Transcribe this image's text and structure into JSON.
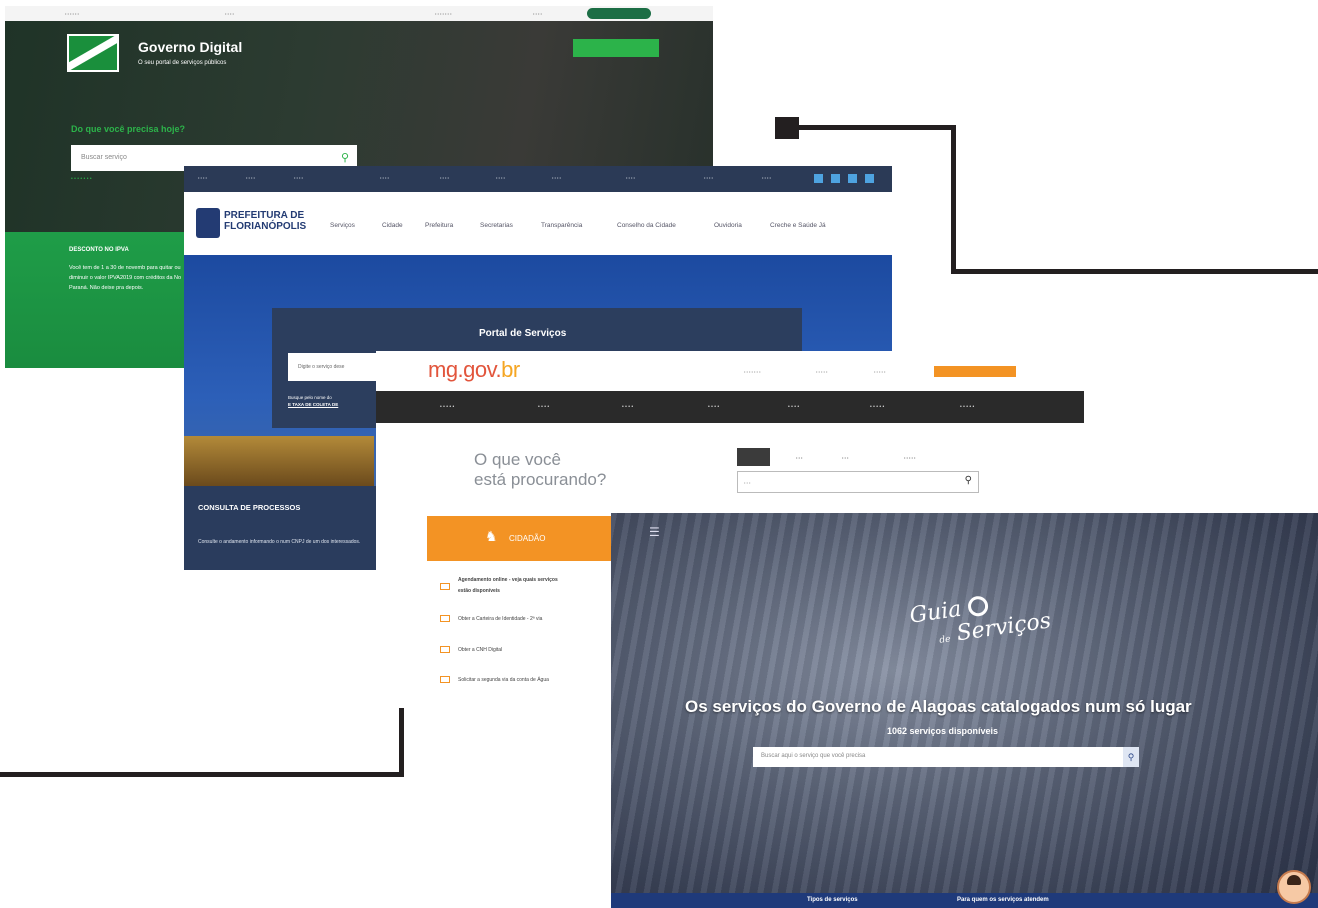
{
  "screens": {
    "parana": {
      "title": "Governo Digital",
      "subtitle": "O seu portal de serviços públicos",
      "question": "Do que você precisa hoje?",
      "search_placeholder": "Buscar serviço",
      "promo_title": "DESCONTO NO IPVA",
      "promo_body": "Você tem de 1 a 30 de novemb para quitar ou diminuir o valor IPVA2019 com créditos da No Paraná. Não deixe pra depois."
    },
    "florianopolis": {
      "logo_text": "PREFEITURA DE FLORIANÓPOLIS",
      "menu": [
        "Serviços",
        "Cidade",
        "Prefeitura",
        "Secretarias",
        "Transparência",
        "Conselho da Cidade",
        "Ouvidoria",
        "Creche e Saúde Já"
      ],
      "portal_title": "Portal de Serviços",
      "search_placeholder": "Digite o serviço dese",
      "panel_note": "Busque pelo nome do",
      "panel_note_2": "E TAXA DE COLETA DE",
      "sidebox_title": "CONSULTA DE PROCESSOS",
      "sidebox_body": "Consulte o andamento informando o num CNPJ de um dos interessados."
    },
    "minas": {
      "logo_main": "mg.gov.",
      "logo_br": "br",
      "heading_line1": "O que você",
      "heading_line2": "está procurando?",
      "cidadao_label": "CIDADÃO",
      "services": [
        "Agendamento online - veja quais serviços",
        "estão disponíveis",
        "Obter a Carteira de Identidade - 2ª via",
        "Obter a CNH Digital",
        "Solicitar a segunda via da conta de Água"
      ]
    },
    "alagoas": {
      "brand_line1": "Guia",
      "brand_de": "de",
      "brand_line2": "Serviços",
      "headline": "Os serviços do Governo de Alagoas catalogados num só lugar",
      "count": "1062 serviços disponíveis",
      "search_placeholder": "Buscar aqui o serviço que você precisa",
      "footer_items": [
        "Tipos de serviços",
        "Para quem os serviços atendem"
      ]
    }
  },
  "colors": {
    "connector": "#231f20",
    "parana_green": "#2cb34a",
    "florianopolis_navy": "#2b3a56",
    "minas_orange": "#f39324",
    "alagoas_blue": "#1f3a7a"
  }
}
